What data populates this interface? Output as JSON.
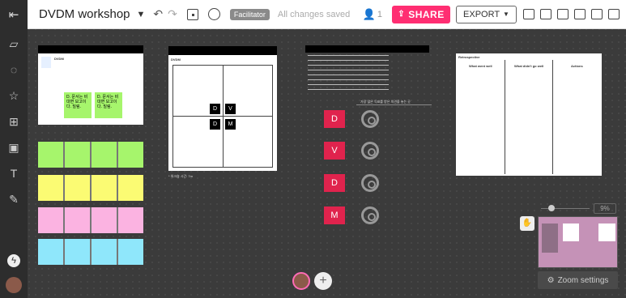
{
  "app": {
    "title": "DVDM workshop",
    "facilitator": "Facilitator",
    "saved": "All changes saved",
    "user_count": "1"
  },
  "toolbar": {
    "share": "SHARE",
    "export": "EXPORT"
  },
  "card1": {
    "title": "DVDM",
    "sticky_a": "D. 문서는 비대면 보고이다. 밀림.",
    "sticky_b": "D. 문서는 비대면 보고이다. 밀림."
  },
  "card2": {
    "title": "DVDM",
    "cells": [
      "D",
      "V",
      "D",
      "M"
    ],
    "caption": "* 워크숍 시간: 7m"
  },
  "card3": {
    "letters": [
      "D",
      "V",
      "D",
      "M"
    ],
    "header": "가장 많은 득표를 받은 의견을 놓는 곳"
  },
  "card4": {
    "title": "Retrospective",
    "cols": [
      "What went well",
      "What didn't go well",
      "Actions"
    ]
  },
  "zoom": {
    "percent": "9%",
    "button": "Zoom settings"
  },
  "colors": {
    "accent": "#ff2e72",
    "green": "#a6f56c",
    "yellow": "#fbfb73",
    "pink": "#fbb3e1",
    "cyan": "#8fe7fb",
    "red": "#e0234d"
  }
}
